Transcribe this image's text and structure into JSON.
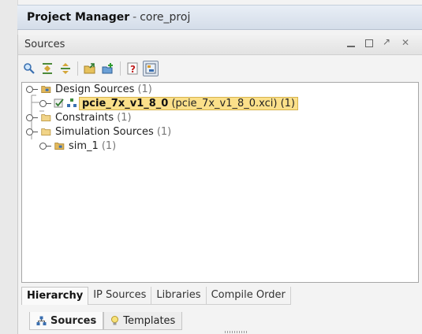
{
  "project_manager": {
    "title": "Project Manager",
    "separator": "-",
    "project": "core_proj"
  },
  "sources_panel": {
    "title": "Sources"
  },
  "toolbar": {
    "icons": [
      "search-icon",
      "collapse-all-icon",
      "expand-all-icon",
      "open-file-icon",
      "add-sources-icon",
      "help-icon",
      "show-hierarchy-icon"
    ]
  },
  "tree": {
    "design_sources": {
      "label": "Design Sources",
      "count": "(1)"
    },
    "pcie_core": {
      "name": "pcie_7x_v1_8_0",
      "detail": "(pcie_7x_v1_8_0.xci) (1)"
    },
    "constraints": {
      "label": "Constraints",
      "count": "(1)"
    },
    "simulation_sources": {
      "label": "Simulation Sources",
      "count": "(1)"
    },
    "sim_1": {
      "label": "sim_1",
      "count": "(1)"
    }
  },
  "view_tabs": [
    "Hierarchy",
    "IP Sources",
    "Libraries",
    "Compile Order"
  ],
  "bottom_tabs": {
    "sources": "Sources",
    "templates": "Templates"
  },
  "colors": {
    "selection": "#fbe08a",
    "title_bar": "#d4dde9",
    "folder": "#e3b85a"
  }
}
